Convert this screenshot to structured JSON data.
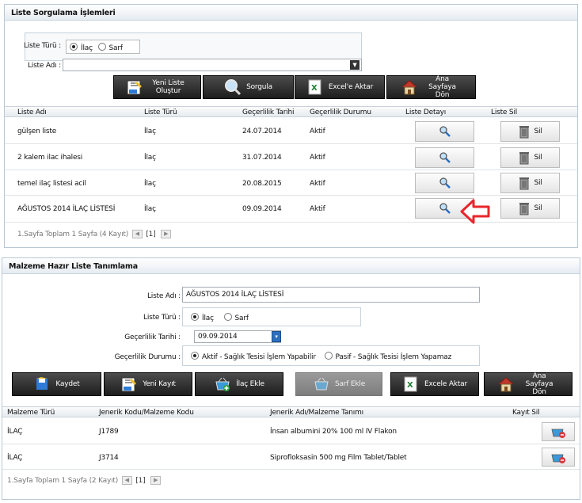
{
  "top": {
    "title": "Liste Sorgulama İşlemleri",
    "liste_turu_label": "Liste Türü :",
    "liste_adi_label": "Liste Adı :",
    "radio_ilac": "İlaç",
    "radio_sarf": "Sarf",
    "buttons": {
      "yeni_liste": "Yeni Liste Oluştur",
      "sorgula": "Sorgula",
      "excel": "Excel'e Aktar",
      "ana_sayfa": "Ana Sayfaya Dön"
    },
    "columns": [
      "Liste Adı",
      "Liste Türü",
      "Geçerlilik Tarihi",
      "Geçerlilik Durumu",
      "Liste Detayı",
      "Liste Sil"
    ],
    "rows": [
      {
        "ad": "gülşen liste",
        "tur": "İlaç",
        "tarih": "24.07.2014",
        "durum": "Aktif"
      },
      {
        "ad": "2 kalem ilac ihalesi",
        "tur": "İlaç",
        "tarih": "31.07.2014",
        "durum": "Aktif"
      },
      {
        "ad": "temel ilaç listesi acil",
        "tur": "İlaç",
        "tarih": "20.08.2015",
        "durum": "Aktif"
      },
      {
        "ad": "AĞUSTOS 2014 İLAÇ LİSTESİ",
        "tur": "İlaç",
        "tarih": "09.09.2014",
        "durum": "Aktif"
      }
    ],
    "sil_label": "Sil",
    "pager_text": "1.Sayfa Toplam 1 Sayfa (4 Kayıt)",
    "page_num": "[1]"
  },
  "bottom": {
    "title": "Malzeme Hazır Liste Tanımlama",
    "liste_adi_label": "Liste Adı :",
    "liste_adi_value": "AĞUSTOS 2014 İLAÇ LİSTESİ",
    "liste_turu_label": "Liste Türü :",
    "radio_ilac": "İlaç",
    "radio_sarf": "Sarf",
    "tarih_label": "Geçerlilik Tarihi :",
    "tarih_value": "09.09.2014",
    "durum_label": "Geçerlilik Durumu :",
    "durum_aktif": "Aktif - Sağlık Tesisi İşlem Yapabilir",
    "durum_pasif": "Pasif - Sağlık Tesisi İşlem Yapamaz",
    "buttons": {
      "kaydet": "Kaydet",
      "yeni_kayit": "Yeni Kayıt",
      "ilac_ekle": "İlaç Ekle",
      "sarf_ekle": "Sarf Ekle",
      "excel": "Excele Aktar",
      "ana_sayfa": "Ana Sayfaya Dön"
    },
    "columns": [
      "Malzeme Türü",
      "Jenerik Kodu/Malzeme Kodu",
      "Jenerik Adı/Malzeme Tanımı",
      "Kayıt Sil"
    ],
    "rows": [
      {
        "tur": "İLAÇ",
        "kod": "J1789",
        "tanim": "İnsan albumini 20% 100 ml IV Flakon"
      },
      {
        "tur": "İLAÇ",
        "kod": "J3714",
        "tanim": "Siprofloksasin 500 mg Film Tablet/Tablet"
      }
    ],
    "pager_text": "1.Sayfa Toplam 1 Sayfa (2 Kayıt)",
    "page_num": "[1]"
  },
  "colors": {
    "arrow": "#e8262b",
    "button_dark": "#2b2b2b",
    "header_border": "#b9c9d6"
  }
}
